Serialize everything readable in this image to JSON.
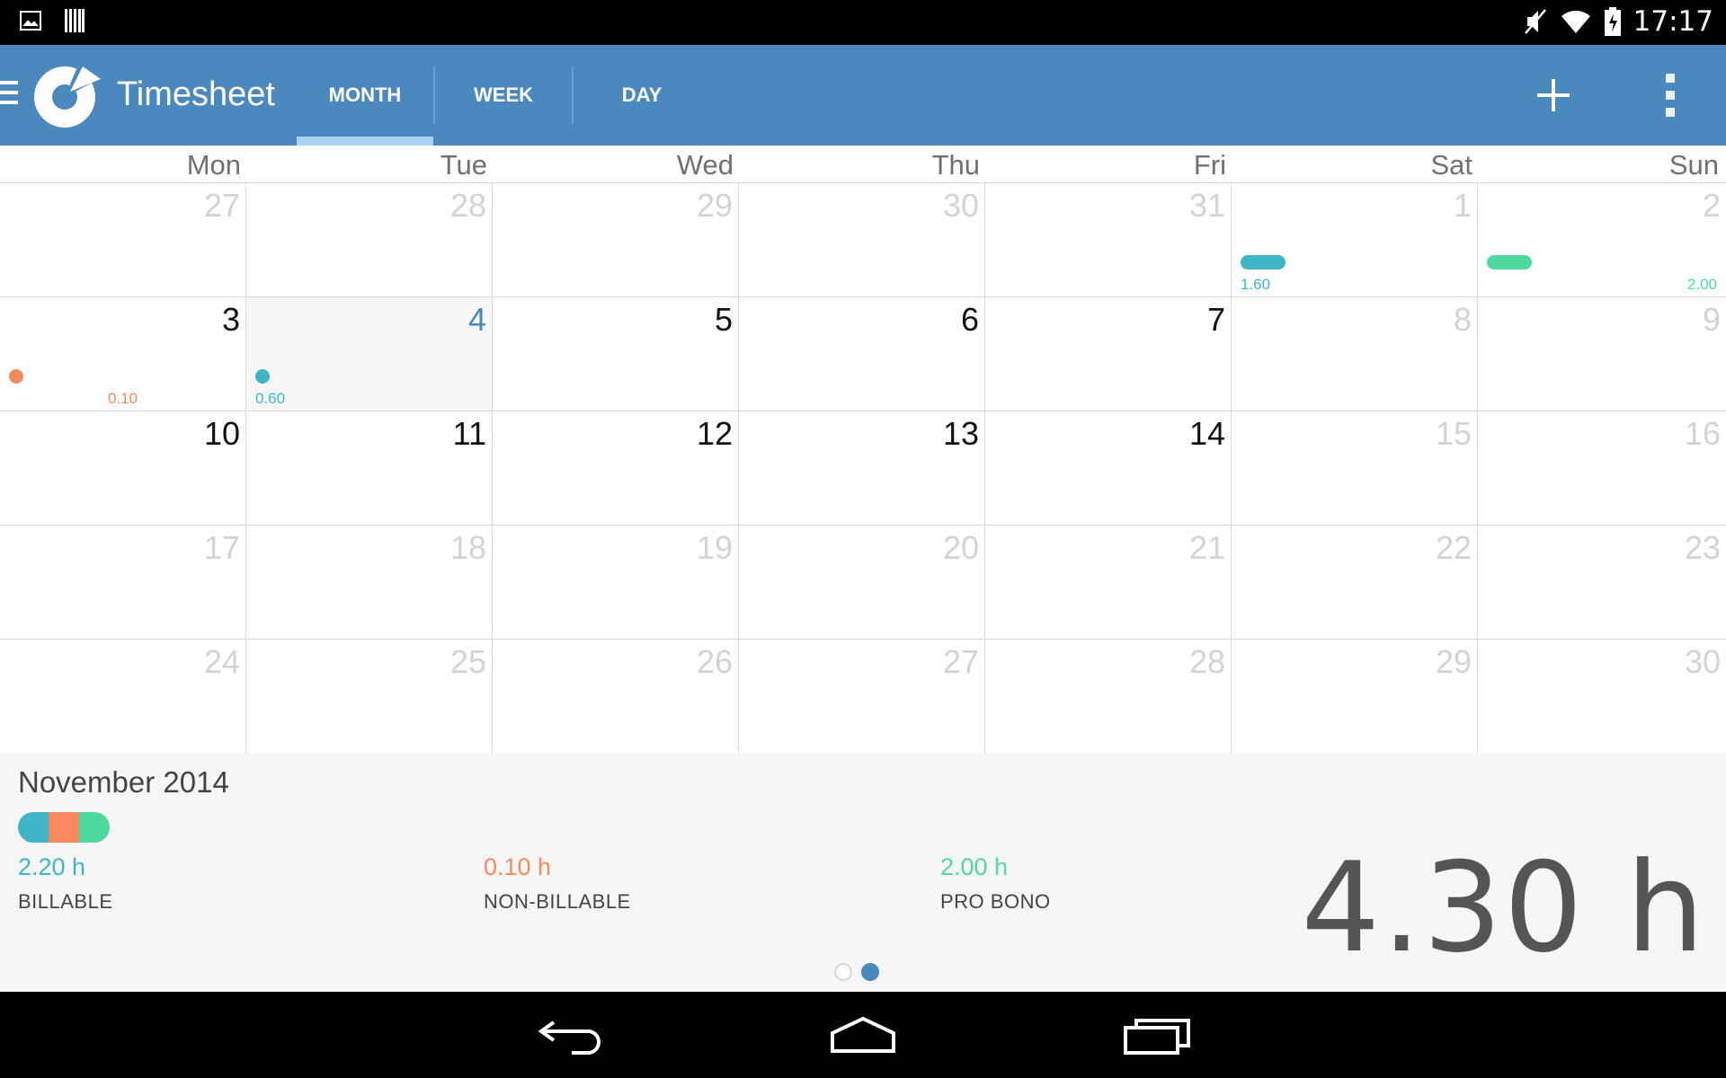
{
  "status_bar": {
    "time": "17:17",
    "left_icons": [
      "image-icon",
      "barcode-icon"
    ],
    "right_icons": [
      "mute-icon",
      "wifi-icon",
      "battery-icon"
    ]
  },
  "app_bar": {
    "title": "Timesheet",
    "tabs": [
      {
        "label": "MONTH",
        "active": true
      },
      {
        "label": "WEEK",
        "active": false
      },
      {
        "label": "DAY",
        "active": false
      }
    ],
    "actions": [
      "add-icon",
      "overflow-menu-icon"
    ]
  },
  "calendar": {
    "weekdays": [
      "Mon",
      "Tue",
      "Wed",
      "Thu",
      "Fri",
      "Sat",
      "Sun"
    ],
    "weeks": [
      [
        {
          "day": "27",
          "dim": true
        },
        {
          "day": "28",
          "dim": true
        },
        {
          "day": "29",
          "dim": true
        },
        {
          "day": "30",
          "dim": true
        },
        {
          "day": "31",
          "dim": true
        },
        {
          "day": "1",
          "dim": true,
          "entry": {
            "type": "billable",
            "hours": "1.60",
            "shape": "pill"
          }
        },
        {
          "day": "2",
          "dim": true,
          "entry": {
            "type": "probono",
            "hours": "2.00",
            "shape": "pill"
          }
        }
      ],
      [
        {
          "day": "3",
          "dim": false,
          "entry": {
            "type": "nonbillable",
            "hours": "0.10",
            "shape": "dot"
          }
        },
        {
          "day": "4",
          "dim": false,
          "today": true,
          "entry": {
            "type": "billable",
            "hours": "0.60",
            "shape": "dot"
          }
        },
        {
          "day": "5",
          "dim": false
        },
        {
          "day": "6",
          "dim": false
        },
        {
          "day": "7",
          "dim": false
        },
        {
          "day": "8",
          "dim": true
        },
        {
          "day": "9",
          "dim": true
        }
      ],
      [
        {
          "day": "10",
          "dim": false
        },
        {
          "day": "11",
          "dim": false
        },
        {
          "day": "12",
          "dim": false
        },
        {
          "day": "13",
          "dim": false
        },
        {
          "day": "14",
          "dim": false
        },
        {
          "day": "15",
          "dim": true
        },
        {
          "day": "16",
          "dim": true
        }
      ],
      [
        {
          "day": "17",
          "dim": true
        },
        {
          "day": "18",
          "dim": true
        },
        {
          "day": "19",
          "dim": true
        },
        {
          "day": "20",
          "dim": true
        },
        {
          "day": "21",
          "dim": true
        },
        {
          "day": "22",
          "dim": true
        },
        {
          "day": "23",
          "dim": true
        }
      ],
      [
        {
          "day": "24",
          "dim": true
        },
        {
          "day": "25",
          "dim": true
        },
        {
          "day": "26",
          "dim": true
        },
        {
          "day": "27",
          "dim": true
        },
        {
          "day": "28",
          "dim": true
        },
        {
          "day": "29",
          "dim": true
        },
        {
          "day": "30",
          "dim": true
        }
      ]
    ]
  },
  "summary": {
    "month": "November 2014",
    "billable": {
      "value": "2.20 h",
      "label": "BILLABLE"
    },
    "nonbillable": {
      "value": "0.10 h",
      "label": "NON-BILLABLE"
    },
    "probono": {
      "value": "2.00 h",
      "label": "PRO BONO"
    },
    "total": "4.30 h",
    "page_indicator": {
      "pages": 2,
      "current": 2
    }
  },
  "colors": {
    "accent": "#4a88bd",
    "billable": "#3fb5c8",
    "nonbillable": "#f7895c",
    "probono": "#4fd99e"
  },
  "nav_bar": [
    "back-icon",
    "home-icon",
    "recents-icon"
  ]
}
